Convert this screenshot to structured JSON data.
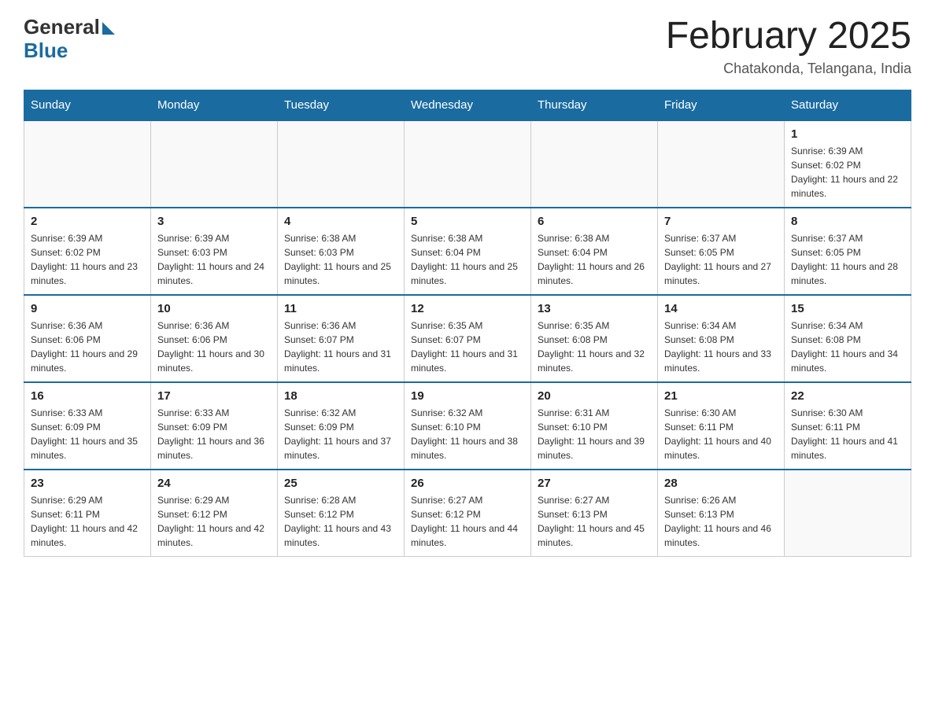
{
  "header": {
    "logo_general": "General",
    "logo_blue": "Blue",
    "month_title": "February 2025",
    "location": "Chatakonda, Telangana, India"
  },
  "weekdays": [
    "Sunday",
    "Monday",
    "Tuesday",
    "Wednesday",
    "Thursday",
    "Friday",
    "Saturday"
  ],
  "weeks": [
    [
      {
        "day": "",
        "info": ""
      },
      {
        "day": "",
        "info": ""
      },
      {
        "day": "",
        "info": ""
      },
      {
        "day": "",
        "info": ""
      },
      {
        "day": "",
        "info": ""
      },
      {
        "day": "",
        "info": ""
      },
      {
        "day": "1",
        "info": "Sunrise: 6:39 AM\nSunset: 6:02 PM\nDaylight: 11 hours and 22 minutes."
      }
    ],
    [
      {
        "day": "2",
        "info": "Sunrise: 6:39 AM\nSunset: 6:02 PM\nDaylight: 11 hours and 23 minutes."
      },
      {
        "day": "3",
        "info": "Sunrise: 6:39 AM\nSunset: 6:03 PM\nDaylight: 11 hours and 24 minutes."
      },
      {
        "day": "4",
        "info": "Sunrise: 6:38 AM\nSunset: 6:03 PM\nDaylight: 11 hours and 25 minutes."
      },
      {
        "day": "5",
        "info": "Sunrise: 6:38 AM\nSunset: 6:04 PM\nDaylight: 11 hours and 25 minutes."
      },
      {
        "day": "6",
        "info": "Sunrise: 6:38 AM\nSunset: 6:04 PM\nDaylight: 11 hours and 26 minutes."
      },
      {
        "day": "7",
        "info": "Sunrise: 6:37 AM\nSunset: 6:05 PM\nDaylight: 11 hours and 27 minutes."
      },
      {
        "day": "8",
        "info": "Sunrise: 6:37 AM\nSunset: 6:05 PM\nDaylight: 11 hours and 28 minutes."
      }
    ],
    [
      {
        "day": "9",
        "info": "Sunrise: 6:36 AM\nSunset: 6:06 PM\nDaylight: 11 hours and 29 minutes."
      },
      {
        "day": "10",
        "info": "Sunrise: 6:36 AM\nSunset: 6:06 PM\nDaylight: 11 hours and 30 minutes."
      },
      {
        "day": "11",
        "info": "Sunrise: 6:36 AM\nSunset: 6:07 PM\nDaylight: 11 hours and 31 minutes."
      },
      {
        "day": "12",
        "info": "Sunrise: 6:35 AM\nSunset: 6:07 PM\nDaylight: 11 hours and 31 minutes."
      },
      {
        "day": "13",
        "info": "Sunrise: 6:35 AM\nSunset: 6:08 PM\nDaylight: 11 hours and 32 minutes."
      },
      {
        "day": "14",
        "info": "Sunrise: 6:34 AM\nSunset: 6:08 PM\nDaylight: 11 hours and 33 minutes."
      },
      {
        "day": "15",
        "info": "Sunrise: 6:34 AM\nSunset: 6:08 PM\nDaylight: 11 hours and 34 minutes."
      }
    ],
    [
      {
        "day": "16",
        "info": "Sunrise: 6:33 AM\nSunset: 6:09 PM\nDaylight: 11 hours and 35 minutes."
      },
      {
        "day": "17",
        "info": "Sunrise: 6:33 AM\nSunset: 6:09 PM\nDaylight: 11 hours and 36 minutes."
      },
      {
        "day": "18",
        "info": "Sunrise: 6:32 AM\nSunset: 6:09 PM\nDaylight: 11 hours and 37 minutes."
      },
      {
        "day": "19",
        "info": "Sunrise: 6:32 AM\nSunset: 6:10 PM\nDaylight: 11 hours and 38 minutes."
      },
      {
        "day": "20",
        "info": "Sunrise: 6:31 AM\nSunset: 6:10 PM\nDaylight: 11 hours and 39 minutes."
      },
      {
        "day": "21",
        "info": "Sunrise: 6:30 AM\nSunset: 6:11 PM\nDaylight: 11 hours and 40 minutes."
      },
      {
        "day": "22",
        "info": "Sunrise: 6:30 AM\nSunset: 6:11 PM\nDaylight: 11 hours and 41 minutes."
      }
    ],
    [
      {
        "day": "23",
        "info": "Sunrise: 6:29 AM\nSunset: 6:11 PM\nDaylight: 11 hours and 42 minutes."
      },
      {
        "day": "24",
        "info": "Sunrise: 6:29 AM\nSunset: 6:12 PM\nDaylight: 11 hours and 42 minutes."
      },
      {
        "day": "25",
        "info": "Sunrise: 6:28 AM\nSunset: 6:12 PM\nDaylight: 11 hours and 43 minutes."
      },
      {
        "day": "26",
        "info": "Sunrise: 6:27 AM\nSunset: 6:12 PM\nDaylight: 11 hours and 44 minutes."
      },
      {
        "day": "27",
        "info": "Sunrise: 6:27 AM\nSunset: 6:13 PM\nDaylight: 11 hours and 45 minutes."
      },
      {
        "day": "28",
        "info": "Sunrise: 6:26 AM\nSunset: 6:13 PM\nDaylight: 11 hours and 46 minutes."
      },
      {
        "day": "",
        "info": ""
      }
    ]
  ]
}
